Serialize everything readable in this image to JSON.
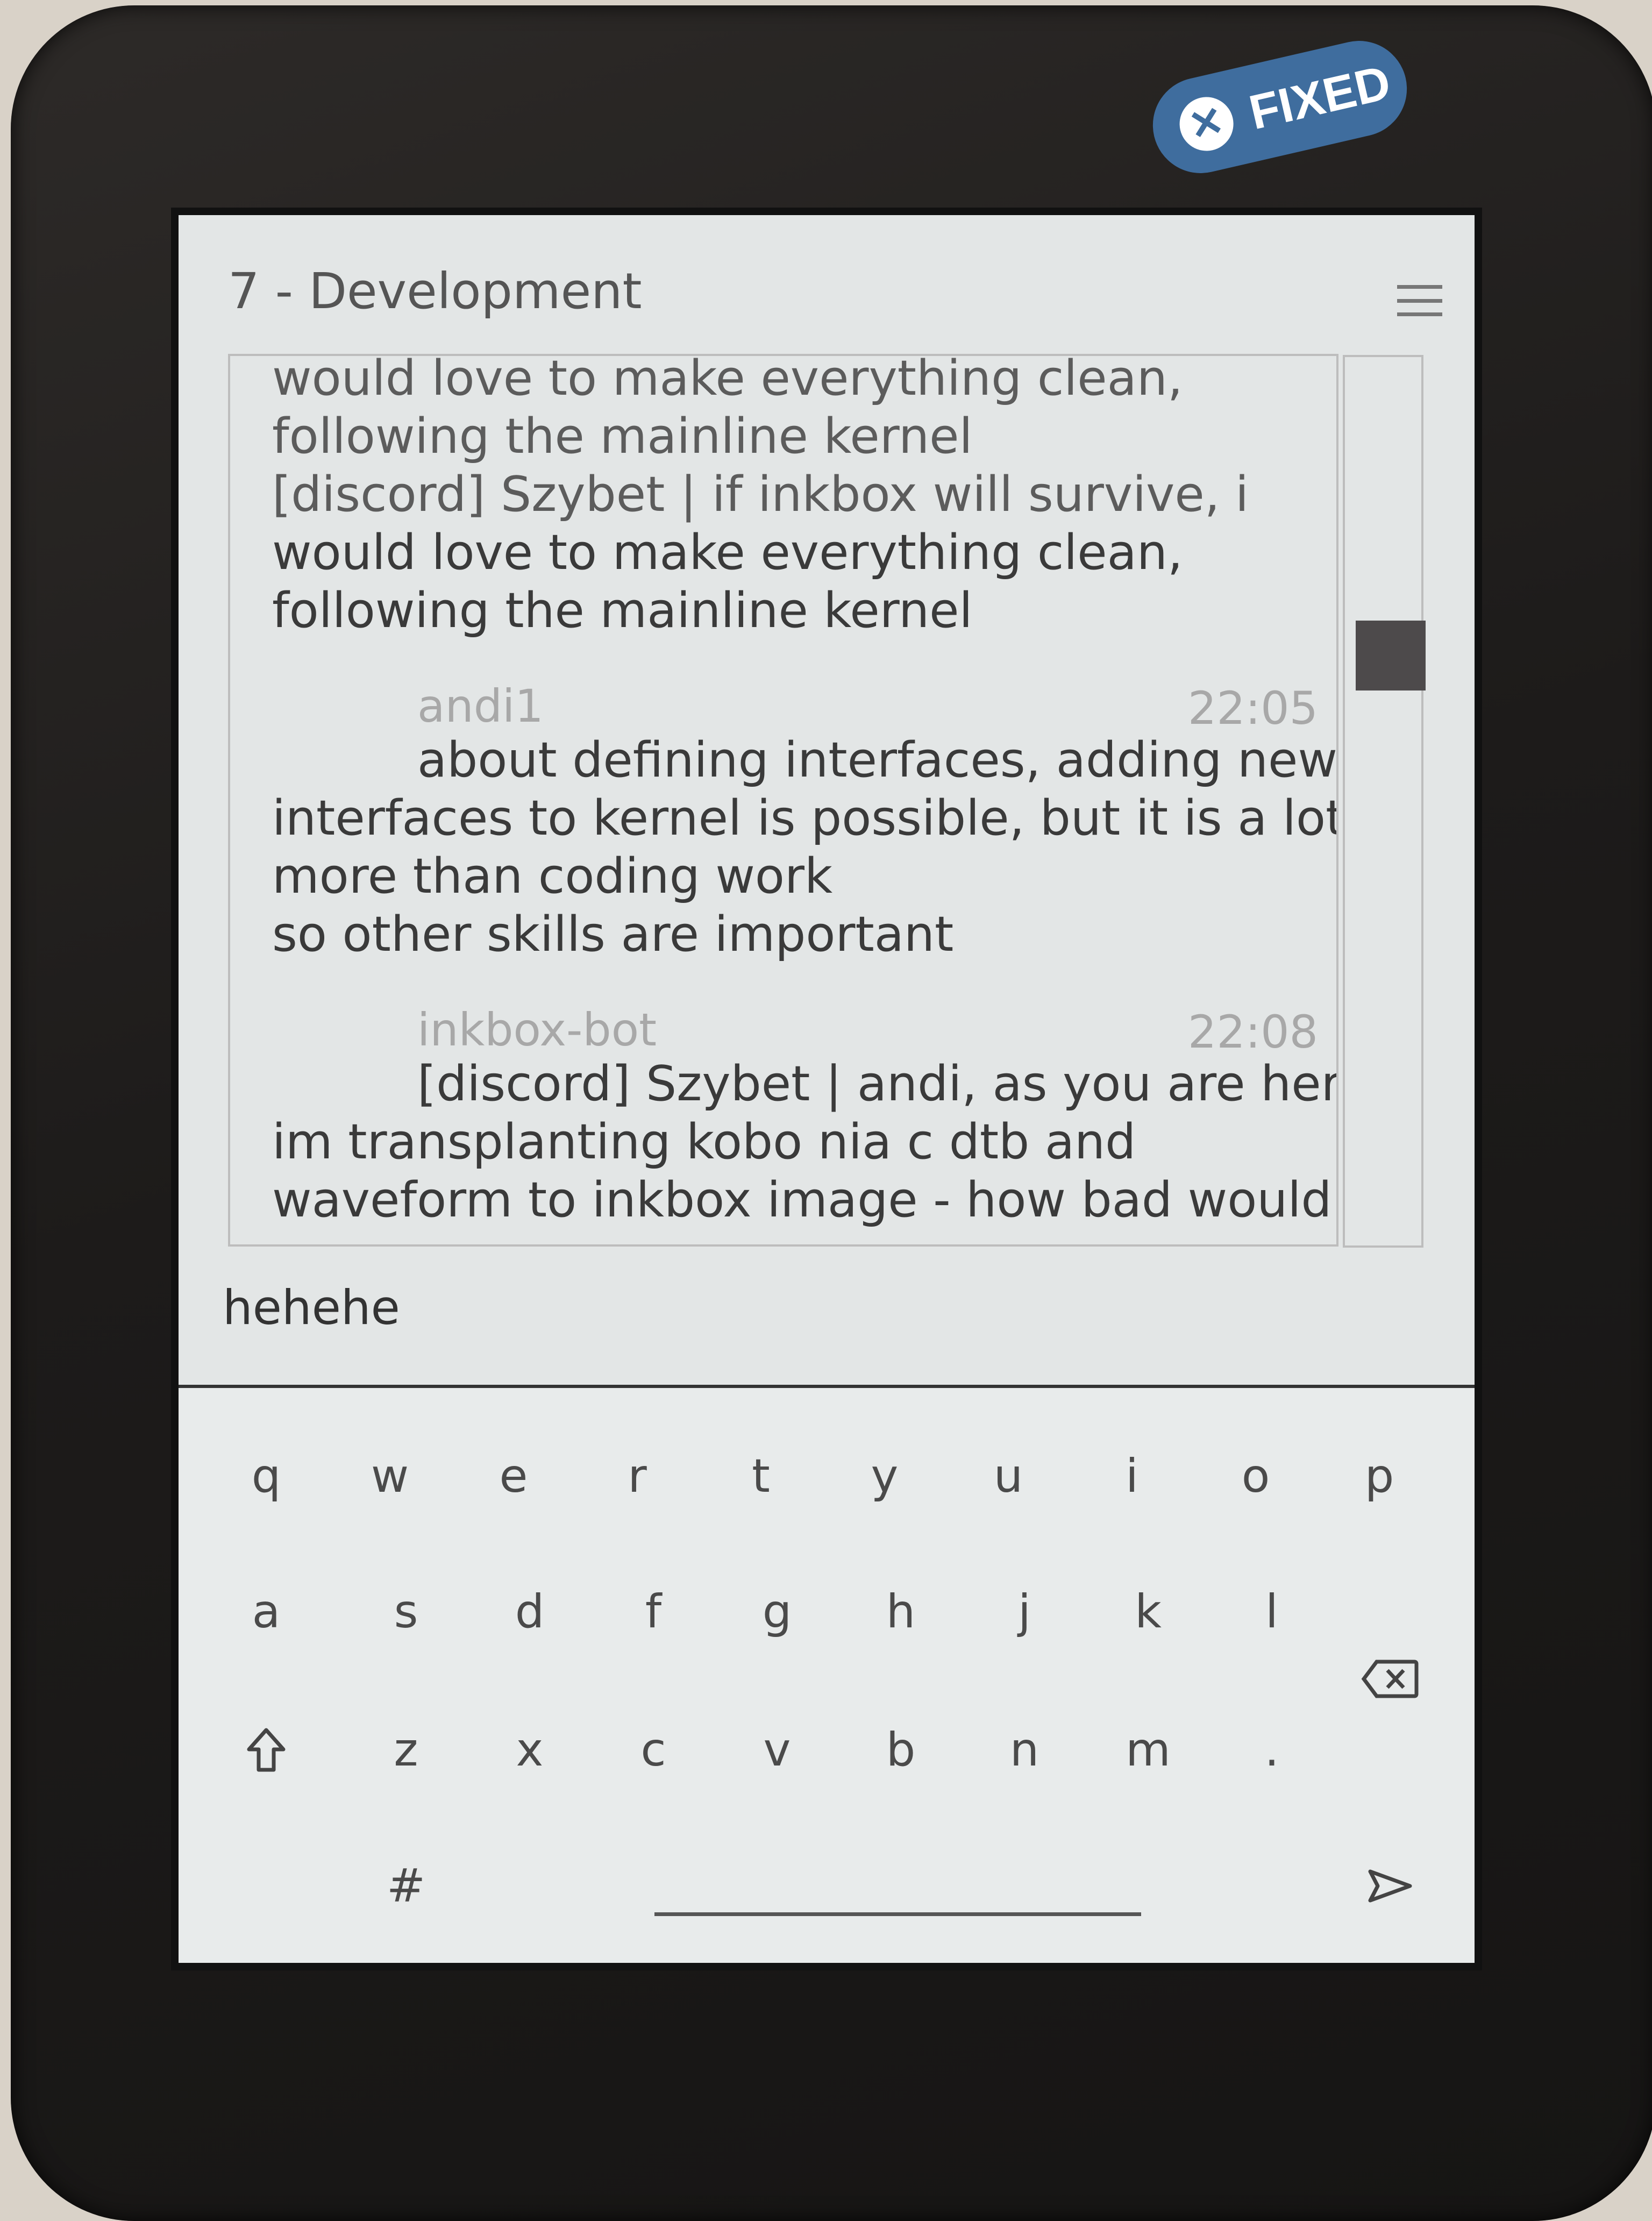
{
  "badge": {
    "label": "FIXED",
    "icon": "close-icon"
  },
  "header": {
    "title": "7 - Development",
    "menu_icon": "hamburger-icon"
  },
  "chat": {
    "top_lines": [
      "would love to make everything clean,",
      "following the mainline kernel",
      "[discord] Szybet | if inkbox will survive, i",
      "would love to make everything clean,",
      "following the mainline kernel"
    ],
    "messages": [
      {
        "author": "andi1",
        "time": "22:05",
        "lines": [
          "about defining interfaces, adding new",
          "interfaces to kernel is possible, but it is a lot",
          "more than coding work",
          "so other skills are important"
        ]
      },
      {
        "author": "inkbox-bot",
        "time": "22:08",
        "lines": [
          "[discord] Szybet | andi, as you are here:",
          "im transplanting kobo nia c dtb and",
          "waveform to inkbox image - how bad would it"
        ]
      }
    ]
  },
  "input": {
    "value": "hehehe"
  },
  "keyboard": {
    "row1": [
      "q",
      "w",
      "e",
      "r",
      "t",
      "y",
      "u",
      "i",
      "o",
      "p"
    ],
    "row2": [
      "a",
      "s",
      "d",
      "f",
      "g",
      "h",
      "j",
      "k",
      "l"
    ],
    "row3": [
      "z",
      "x",
      "c",
      "v",
      "b",
      "n",
      "m",
      "."
    ],
    "shift_icon": "shift-icon",
    "backspace_icon": "backspace-icon",
    "symbols_label": "#",
    "send_icon": "send-icon"
  }
}
